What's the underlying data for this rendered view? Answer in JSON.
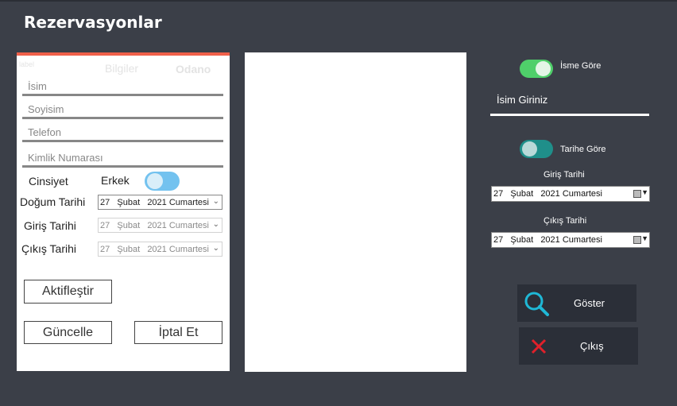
{
  "app": {
    "title": "Rezervasyonlar"
  },
  "form": {
    "faded_tabs": {
      "label": "label",
      "bilgiler": "Bilgiler",
      "odano": "Odano"
    },
    "fields": {
      "isim": "İsim",
      "soyisim": "Soyisim",
      "telefon": "Telefon",
      "kimlik": "Kimlik Numarası"
    },
    "cinsiyet_label": "Cinsiyet",
    "gender_value": "Erkek",
    "dogum_label": "Doğum Tarihi",
    "giris_label": "Giriş Tarihi",
    "cikis_label": "Çıkış Tarihi",
    "dogum_value": "27   Şubat   2021 Cumartesi",
    "giris_value": "27   Şubat   2021 Cumartesi",
    "cikis_value": "27   Şubat   2021 Cumartesi",
    "aktiflestir_btn": "Aktifleştir",
    "guncelle_btn": "Güncelle",
    "iptal_btn": "İptal Et"
  },
  "search": {
    "isme_gore_label": "İsme Göre",
    "name_placeholder": "İsim Giriniz",
    "tarihe_gore_label": "Tarihe Göre",
    "giris_label": "Giriş Tarihi",
    "cikis_label": "Çıkış Tarihi",
    "giris_value": "27   Şubat   2021 Cumartesi",
    "cikis_value": "27   Şubat   2021 Cumartesi",
    "goster_btn": "Göster",
    "cikis_btn": "Çıkış"
  },
  "colors": {
    "background": "#3b3f48",
    "accent_bar": "#f0604a",
    "toggle_name_on": "#4fcf6a",
    "toggle_date_off": "#1f8f8a",
    "toggle_gender": "#73c2ef",
    "search_icon": "#1fb8d6",
    "close_icon": "#e0202a",
    "dark_button": "#2b2f38"
  },
  "icons": {
    "goster": "search-icon",
    "cikis": "close-icon"
  }
}
